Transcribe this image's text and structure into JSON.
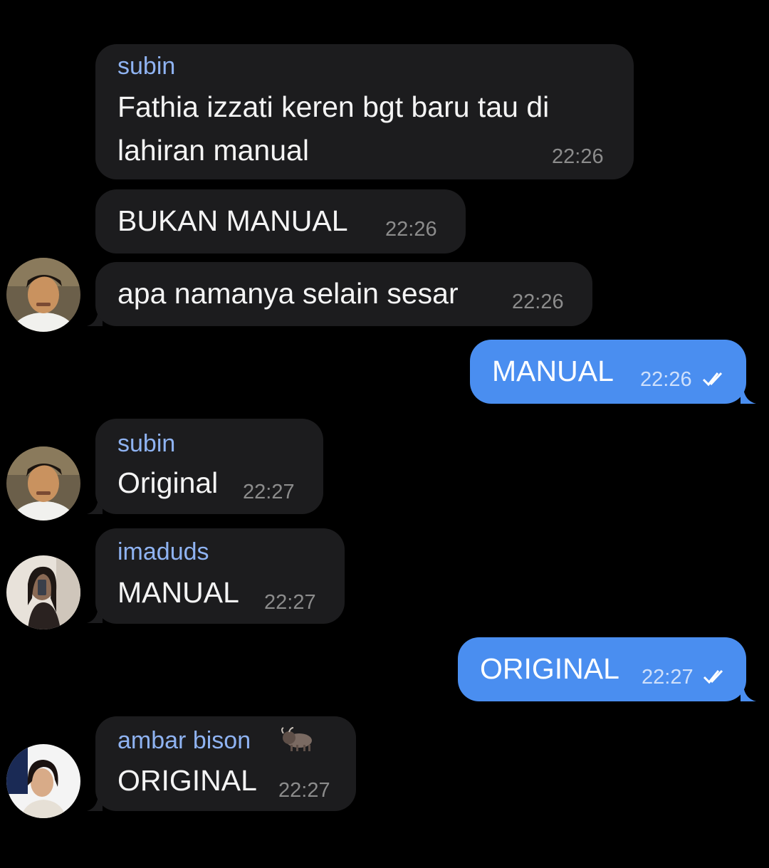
{
  "messages": [
    {
      "sender": "subin",
      "text_line1": "Fathia izzati keren bgt baru tau di",
      "text_line2": "lahiran manual",
      "time": "22:26"
    },
    {
      "text": "BUKAN MANUAL",
      "time": "22:26"
    },
    {
      "text": "apa namanya selain sesar",
      "time": "22:26"
    },
    {
      "text": "MANUAL",
      "time": "22:26",
      "outgoing": true
    },
    {
      "sender": "subin",
      "text": "Original",
      "time": "22:27"
    },
    {
      "sender": "imaduds",
      "text": "MANUAL",
      "time": "22:27"
    },
    {
      "text": "ORIGINAL",
      "time": "22:27",
      "outgoing": true
    },
    {
      "sender": "ambar bison",
      "sender_emoji_icon": "bison-icon",
      "text": "ORIGINAL",
      "time": "22:27"
    }
  ],
  "icons": {
    "read_receipt": "double-check-icon",
    "avatar_subin": "avatar-subin",
    "avatar_imaduds": "avatar-imaduds",
    "avatar_ambar": "avatar-ambar-bison"
  },
  "colors": {
    "background": "#000000",
    "incoming_bubble": "#1c1c1e",
    "outgoing_bubble": "#4a8ef0",
    "sender_name": "#8fb3f2",
    "timestamp": "#8c8c8c"
  }
}
